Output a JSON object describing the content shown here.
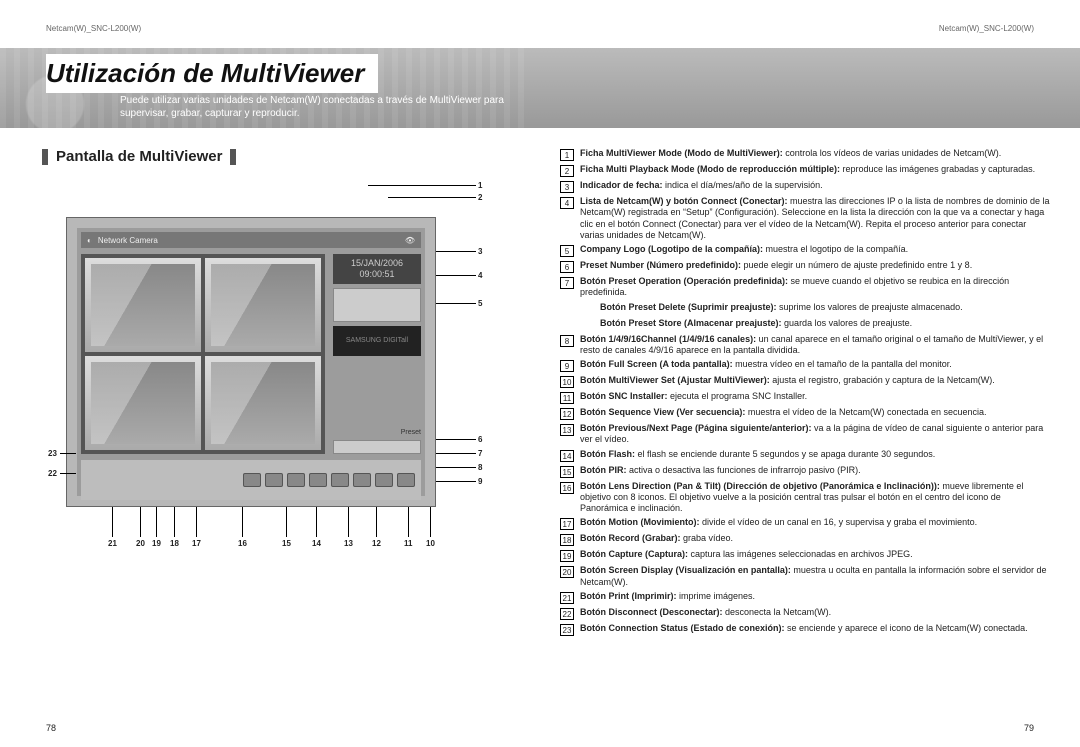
{
  "running_head": {
    "left": "Netcam(W)_SNC-L200(W)",
    "right": "Netcam(W)_SNC-L200(W)"
  },
  "banner": {
    "title": "Utilización de MultiViewer",
    "sub": "Puede utilizar varias unidades de Netcam(W) conectadas a través de MultiViewer para supervisar, grabar, capturar y reproducir."
  },
  "section_title": "Pantalla de MultiViewer",
  "screenshot": {
    "window_title": "Network Camera",
    "date": "15/JAN/2006",
    "time": "09:00:51",
    "logo_text": "SAMSUNG DIGITall",
    "preset_label": "Preset"
  },
  "callouts": {
    "right": [
      "1",
      "2",
      "3",
      "4",
      "5",
      "6",
      "7",
      "8",
      "9"
    ],
    "left": [
      "22",
      "23"
    ],
    "bottom": [
      "21",
      "20",
      "19",
      "18",
      "17",
      "16",
      "15",
      "14",
      "13",
      "12",
      "11",
      "10"
    ]
  },
  "defs": [
    {
      "n": "1",
      "text": "<b>Ficha MultiViewer Mode (Modo de MultiViewer):</b> controla los vídeos de varias unidades de Netcam(W)."
    },
    {
      "n": "2",
      "text": "<b>Ficha Multi Playback Mode (Modo de reproducción múltiple):</b> reproduce las imágenes grabadas y capturadas."
    },
    {
      "n": "3",
      "text": "<b>Indicador de fecha:</b> indica el día/mes/año de la supervisión."
    },
    {
      "n": "4",
      "text": "<b>Lista de Netcam(W) y botón Connect (Conectar):</b> muestra las direcciones IP o la lista de nombres de dominio de la Netcam(W) registrada en “Setup” (Configuración). Seleccione en la lista la dirección con la que va a conectar y haga clic en el botón Connect (Conectar) para ver el vídeo de la Netcam(W). Repita el proceso anterior para conectar varias unidades de Netcam(W)."
    },
    {
      "n": "5",
      "text": "<b>Company Logo (Logotipo de la compañía):</b> muestra el logotipo de la compañía."
    },
    {
      "n": "6",
      "text": "<b>Preset Number (Número predefinido):</b> puede elegir un número de ajuste predefinido entre 1 y 8."
    },
    {
      "n": "7",
      "text": "<b>Botón Preset Operation (Operación predefinida):</b> se mueve cuando el objetivo se reubica en la dirección predefinida."
    },
    {
      "n": "",
      "text": "<b>Botón Preset Delete (Suprimir preajuste):</b> suprime los valores de preajuste almacenado."
    },
    {
      "n": "",
      "text": "<b>Botón Preset Store (Almacenar preajuste):</b> guarda los valores de preajuste."
    },
    {
      "n": "8",
      "text": "<b>Botón 1/4/9/16Channel (1/4/9/16 canales):</b> un canal aparece en el tamaño original o el tamaño de MultiViewer, y el resto de canales 4/9/16 aparece en la pantalla dividida."
    },
    {
      "n": "9",
      "text": "<b>Botón Full Screen (A toda pantalla):</b> muestra vídeo en el tamaño de la pantalla del monitor."
    },
    {
      "n": "10",
      "text": "<b>Botón MultiViewer Set (Ajustar MultiViewer):</b> ajusta el registro, grabación y captura de la Netcam(W)."
    },
    {
      "n": "11",
      "text": "<b>Botón SNC Installer:</b> ejecuta el programa SNC Installer."
    },
    {
      "n": "12",
      "text": "<b>Botón Sequence View (Ver secuencia):</b> muestra el vídeo de la Netcam(W) conectada en secuencia."
    },
    {
      "n": "13",
      "text": "<b>Botón Previous/Next Page (Página siguiente/anterior):</b> va a la página de vídeo de canal siguiente o anterior para ver el vídeo."
    },
    {
      "n": "14",
      "text": "<b>Botón Flash:</b> el flash se enciende durante 5 segundos y se apaga durante 30 segundos."
    },
    {
      "n": "15",
      "text": "<b>Botón PIR:</b> activa o desactiva las funciones de infrarrojo pasivo (PIR)."
    },
    {
      "n": "16",
      "text": "<b>Botón Lens Direction (Pan & Tilt) (Dirección de objetivo (Panorámica e Inclinación)):</b> mueve libremente el objetivo con 8 iconos. El objetivo vuelve a la posición central tras pulsar el botón en el centro del icono de Panorámica e inclinación."
    },
    {
      "n": "17",
      "text": "<b>Botón Motion (Movimiento):</b> divide el vídeo de un canal en 16, y supervisa y graba el movimiento."
    },
    {
      "n": "18",
      "text": "<b>Botón Record (Grabar):</b> graba vídeo."
    },
    {
      "n": "19",
      "text": "<b>Botón Capture (Captura):</b> captura las imágenes seleccionadas en archivos JPEG."
    },
    {
      "n": "20",
      "text": "<b>Botón Screen Display (Visualización en pantalla):</b> muestra u oculta en pantalla la información sobre el servidor de Netcam(W)."
    },
    {
      "n": "21",
      "text": "<b>Botón Print (Imprimir):</b> imprime imágenes."
    },
    {
      "n": "22",
      "text": "<b>Botón Disconnect (Desconectar):</b> desconecta la Netcam(W)."
    },
    {
      "n": "23",
      "text": "<b>Botón Connection Status (Estado de conexión):</b> se enciende y aparece el icono de la Netcam(W) conectada."
    }
  ],
  "pages": {
    "left": "78",
    "right": "79"
  }
}
